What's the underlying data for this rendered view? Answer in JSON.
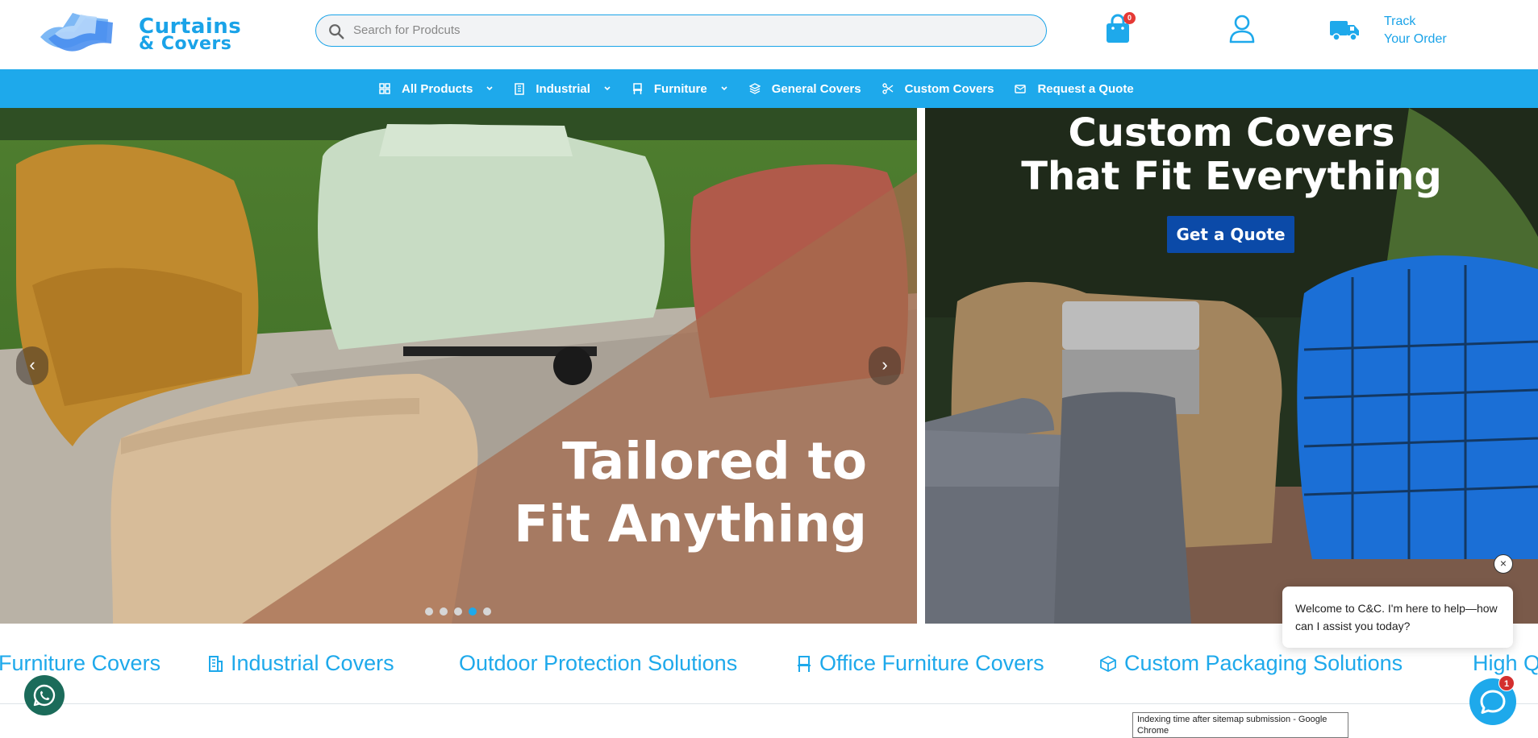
{
  "brand": {
    "name_line1": "Curtains",
    "name_line2": "& Covers",
    "primary_color": "#1ea9eb",
    "dark_blue": "#0b4aa8"
  },
  "header": {
    "search_placeholder": "Search for Prodcuts",
    "cart_count": "0",
    "track_line1": "Track",
    "track_line2": "Your Order"
  },
  "nav": {
    "items": [
      {
        "label": "All Products",
        "icon": "grid-icon",
        "dropdown": true
      },
      {
        "label": "Industrial",
        "icon": "building-icon",
        "dropdown": true
      },
      {
        "label": "Furniture",
        "icon": "chair-icon",
        "dropdown": true
      },
      {
        "label": "General Covers",
        "icon": "layers-icon",
        "dropdown": false
      },
      {
        "label": "Custom Covers",
        "icon": "scissors-icon",
        "dropdown": false
      },
      {
        "label": "Request a Quote",
        "icon": "quote-icon",
        "dropdown": false
      }
    ]
  },
  "hero": {
    "title_line1": "Tailored to",
    "title_line2": "Fit Anything",
    "prev_arrow": "‹",
    "next_arrow": "›",
    "slide_count": 5,
    "active_slide": 4
  },
  "promo": {
    "title_line1": "Custom Covers",
    "title_line2": "That Fit Everything",
    "button_label": "Get a Quote"
  },
  "marquee": {
    "items": [
      {
        "label": "Furniture Covers",
        "icon": ""
      },
      {
        "label": "Industrial Covers",
        "icon": "building-icon"
      },
      {
        "label": "Outdoor Protection Solutions",
        "icon": ""
      },
      {
        "label": "Office Furniture Covers",
        "icon": "chair-icon"
      },
      {
        "label": "Custom Packaging Solutions",
        "icon": "box-icon"
      },
      {
        "label": "High Q",
        "icon": ""
      }
    ]
  },
  "chat": {
    "close_label": "×",
    "message": "Welcome to C&C. I'm here to help—how can I assist you today?",
    "unread_count": "1"
  },
  "tooltip": {
    "text": "Indexing time after sitemap submission - Google Chrome"
  }
}
